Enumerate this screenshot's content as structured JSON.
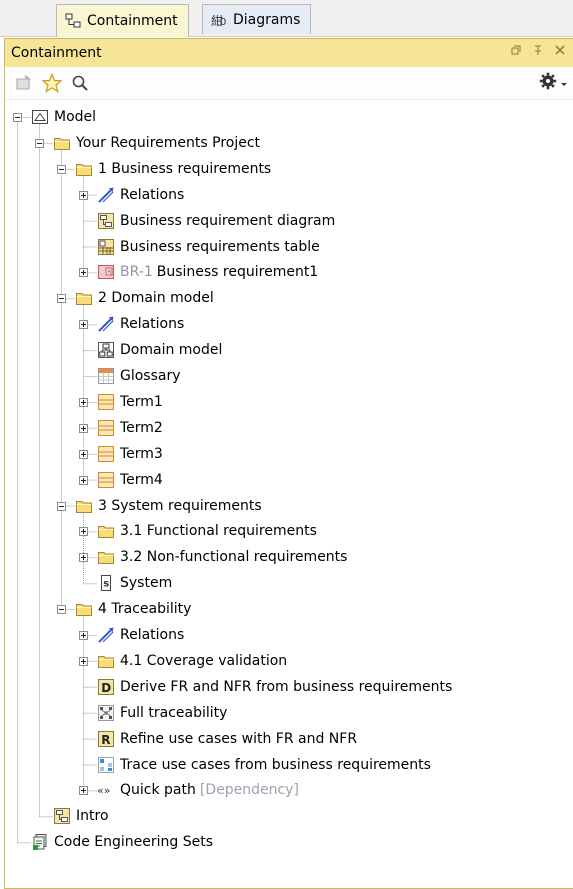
{
  "tabs": [
    {
      "label": "Containment",
      "active": true,
      "icon": "containment-tree-icon"
    },
    {
      "label": "Diagrams",
      "active": false,
      "icon": "diagrams-icon"
    }
  ],
  "panel": {
    "title": "Containment",
    "controls": [
      "restore-icon",
      "pin-icon",
      "close-icon"
    ],
    "toolbar": [
      "new-element-icon",
      "favorite-star-icon",
      "search-icon"
    ],
    "options_icon": "gear-icon"
  },
  "tree": [
    {
      "depth": 0,
      "toggle": "minus",
      "icon": "model",
      "label": "Model"
    },
    {
      "depth": 1,
      "toggle": "minus",
      "icon": "folder",
      "label": "Your Requirements Project"
    },
    {
      "depth": 2,
      "toggle": "minus",
      "icon": "folder",
      "label": "1 Business requirements"
    },
    {
      "depth": 3,
      "toggle": "plus",
      "icon": "relation",
      "label": "Relations"
    },
    {
      "depth": 3,
      "toggle": "none",
      "icon": "diagram",
      "label": "Business requirement diagram"
    },
    {
      "depth": 3,
      "toggle": "none",
      "icon": "table",
      "label": "Business requirements table"
    },
    {
      "depth": 3,
      "toggle": "plus",
      "icon": "requirement",
      "prefix": "BR-1",
      "label": "Business requirement1"
    },
    {
      "depth": 2,
      "toggle": "minus",
      "icon": "folder",
      "label": "2 Domain model"
    },
    {
      "depth": 3,
      "toggle": "plus",
      "icon": "relation",
      "label": "Relations"
    },
    {
      "depth": 3,
      "toggle": "none",
      "icon": "class-diagram",
      "label": "Domain model"
    },
    {
      "depth": 3,
      "toggle": "none",
      "icon": "glossary",
      "label": "Glossary"
    },
    {
      "depth": 3,
      "toggle": "plus",
      "icon": "term",
      "label": "Term1"
    },
    {
      "depth": 3,
      "toggle": "plus",
      "icon": "term",
      "label": "Term2"
    },
    {
      "depth": 3,
      "toggle": "plus",
      "icon": "term",
      "label": "Term3"
    },
    {
      "depth": 3,
      "toggle": "plus",
      "icon": "term",
      "label": "Term4"
    },
    {
      "depth": 2,
      "toggle": "minus",
      "icon": "folder",
      "label": "3 System requirements"
    },
    {
      "depth": 3,
      "toggle": "plus",
      "icon": "folder",
      "label": "3.1 Functional requirements"
    },
    {
      "depth": 3,
      "toggle": "plus",
      "icon": "folder",
      "label": "3.2 Non-functional requirements"
    },
    {
      "depth": 3,
      "toggle": "none",
      "icon": "system",
      "label": "System"
    },
    {
      "depth": 2,
      "toggle": "minus",
      "icon": "folder",
      "label": "4 Traceability"
    },
    {
      "depth": 3,
      "toggle": "plus",
      "icon": "relation",
      "label": "Relations"
    },
    {
      "depth": 3,
      "toggle": "plus",
      "icon": "folder",
      "label": "4.1 Coverage validation"
    },
    {
      "depth": 3,
      "toggle": "none",
      "icon": "derive",
      "label": "Derive FR and NFR from business requirements"
    },
    {
      "depth": 3,
      "toggle": "none",
      "icon": "traceability",
      "label": "Full traceability"
    },
    {
      "depth": 3,
      "toggle": "none",
      "icon": "refine",
      "label": "Refine use cases with FR and NFR"
    },
    {
      "depth": 3,
      "toggle": "none",
      "icon": "trace",
      "label": "Trace use cases from business requirements"
    },
    {
      "depth": 3,
      "toggle": "plus",
      "icon": "dependency",
      "label": "Quick path",
      "suffix": "[Dependency]"
    },
    {
      "depth": 1,
      "toggle": "none",
      "icon": "diagram",
      "label": "Intro"
    },
    {
      "depth": 0,
      "toggle": "none",
      "icon": "code-sets",
      "label": "Code Engineering Sets"
    }
  ],
  "colors": {
    "panel_title_bg": "#f6e596",
    "active_tab_bg": "#fbf6d2",
    "folder": "#f7dc7a",
    "relation": "#3a58c8",
    "secondary_text": "#8a95a8"
  }
}
